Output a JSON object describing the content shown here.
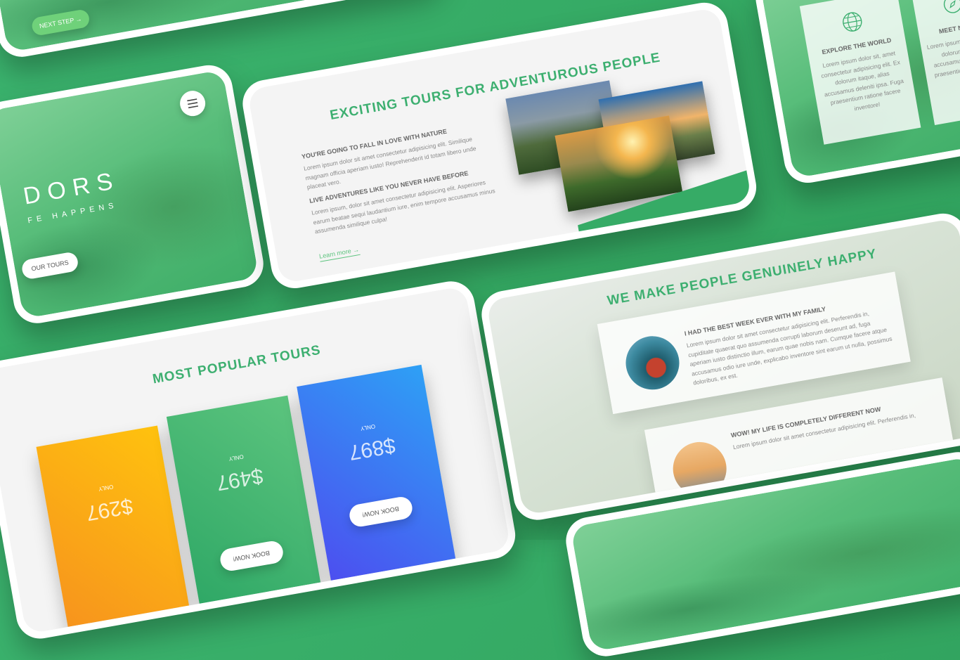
{
  "hero_top": {
    "next_step_label": "NEXT STEP →"
  },
  "hero_left": {
    "title_fragment": "DORS",
    "subtitle_fragment": "FE HAPPENS",
    "tours_button": "OUR TOURS",
    "menu_icon": "hamburger-menu-icon"
  },
  "about": {
    "heading": "EXCITING TOURS FOR ADVENTUROUS PEOPLE",
    "block1_title": "YOU'RE GOING TO FALL IN LOVE WITH NATURE",
    "block1_text": "Lorem ipsum dolor sit amet consectetur adipisicing elit. Similique magnam officia aperiam iusto! Reprehenderit id totam libero unde placeat vero.",
    "block2_title": "LIVE ADVENTURES LIKE YOU NEVER HAVE BEFORE",
    "block2_text": "Lorem ipsum, dolor sit amet consectetur adipisicing elit. Asperiores earum beatae sequi laudantium iure, enim tempore accusamus minus assumenda similique culpa!",
    "learn_more": "Learn more →"
  },
  "features": {
    "items": [
      {
        "title": "EXPLORE THE WORLD",
        "icon": "globe-icon",
        "text": "Lorem ipsum dolor sit, amet consectetur adipisicing elit. Ex dolorum itaque, alias accusamus deleniti ipsa. Fuga praesentium ratione facere inventore!"
      },
      {
        "title": "MEET NATU",
        "icon": "compass-icon",
        "text": "Lorem ipsum dolor sit Ex dolorum itaque accusamus dele Fuga praesentium facere inv"
      }
    ]
  },
  "tours": {
    "heading": "MOST POPULAR TOURS",
    "cards": [
      {
        "only": "ONLY",
        "price": "$297",
        "button": "BOOK NOW!",
        "color_from": "#f7a21b",
        "color_to": "#ffc20e"
      },
      {
        "only": "ONLY",
        "price": "$497",
        "button": "BOOK NOW!",
        "color_from": "#2fa866",
        "color_to": "#5cc47e"
      },
      {
        "only": "ONLY",
        "price": "$897",
        "button": "BOOK NOW!",
        "color_from": "#4c4ff0",
        "color_to": "#2ea0f5"
      }
    ]
  },
  "stories": {
    "heading": "WE MAKE PEOPLE GENUINELY HAPPY",
    "items": [
      {
        "title": "I HAD THE BEST WEEK EVER WITH MY FAMILY",
        "text": "Lorem ipsum dolor sit amet consectetur adipisicing elit. Perferendis in, cupiditate quaerat quo assumenda corrupti laborum deserunt ad, fuga aperiam iusto distinctio illum, earum quae nobis nam. Cumque facere atque accusamus odio iure unde, explicabo inventore sint earum ut nulla, possimus doloribus, ex est."
      },
      {
        "title": "WOW! MY LIFE IS COMPLETELY DIFFERENT NOW",
        "text": "Lorem ipsum dolor sit amet consectetur adipisicing elit. Perferendis in,"
      }
    ]
  },
  "colors": {
    "brand_green": "#3daf70",
    "background": "#35a964"
  }
}
